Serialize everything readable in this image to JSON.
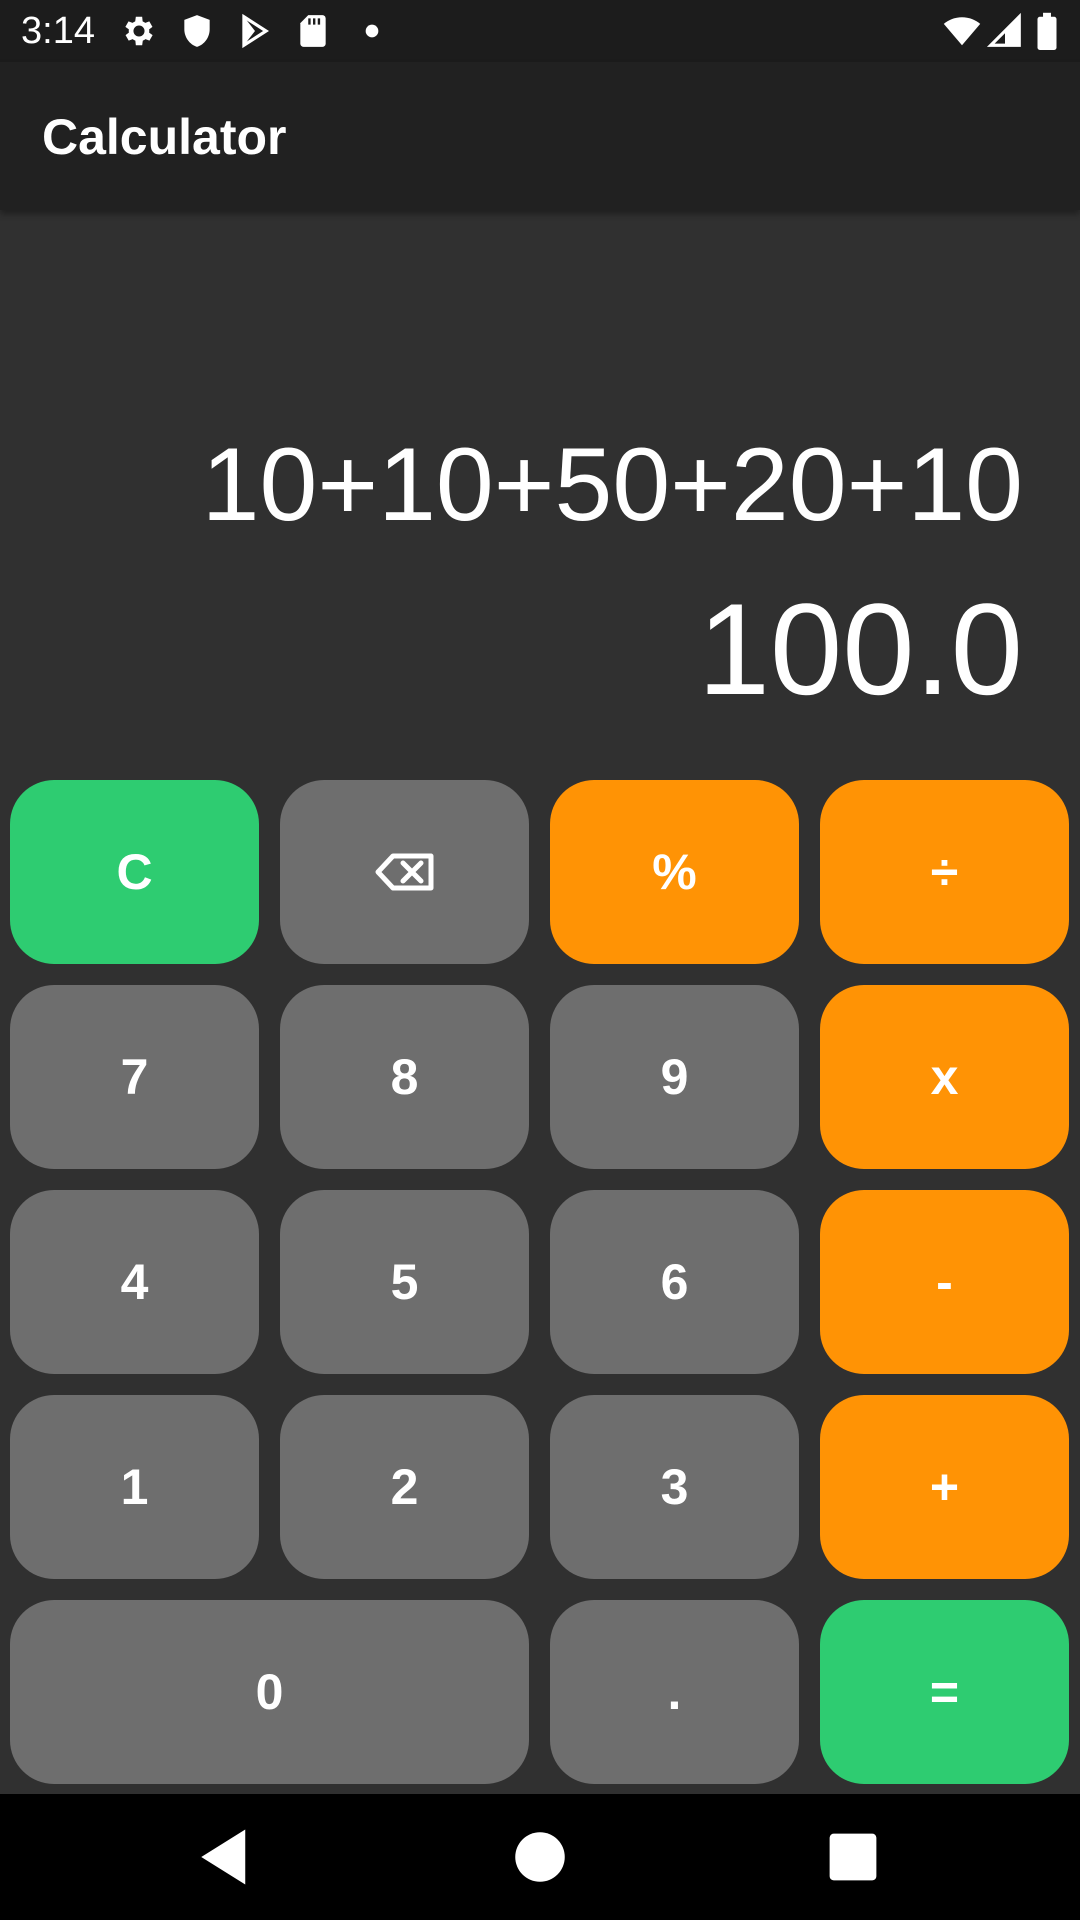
{
  "status_bar": {
    "time": "3:14",
    "left_icons": [
      "gear-icon",
      "shield-icon",
      "play-store-icon",
      "sd-card-icon",
      "dot-icon"
    ],
    "right_icons": [
      "wifi-icon",
      "signal-icon",
      "battery-icon"
    ]
  },
  "app_bar": {
    "title": "Calculator"
  },
  "display": {
    "expression": "10+10+50+20+10",
    "result": "100.0"
  },
  "keypad": {
    "clear": "C",
    "backspace_icon": "backspace-icon",
    "percent": "%",
    "divide": "÷",
    "seven": "7",
    "eight": "8",
    "nine": "9",
    "multiply": "x",
    "four": "4",
    "five": "5",
    "six": "6",
    "subtract": "-",
    "one": "1",
    "two": "2",
    "three": "3",
    "add": "+",
    "zero": "0",
    "decimal": ".",
    "equals": "="
  },
  "colors": {
    "background": "#303030",
    "app_bar": "#212121",
    "number_key": "#6e6e6e",
    "operator_key": "#ff9305",
    "action_key": "#2ecc71",
    "text": "#ffffff"
  },
  "nav_bar": {
    "icons": [
      "back-icon",
      "home-icon",
      "recents-icon"
    ]
  }
}
